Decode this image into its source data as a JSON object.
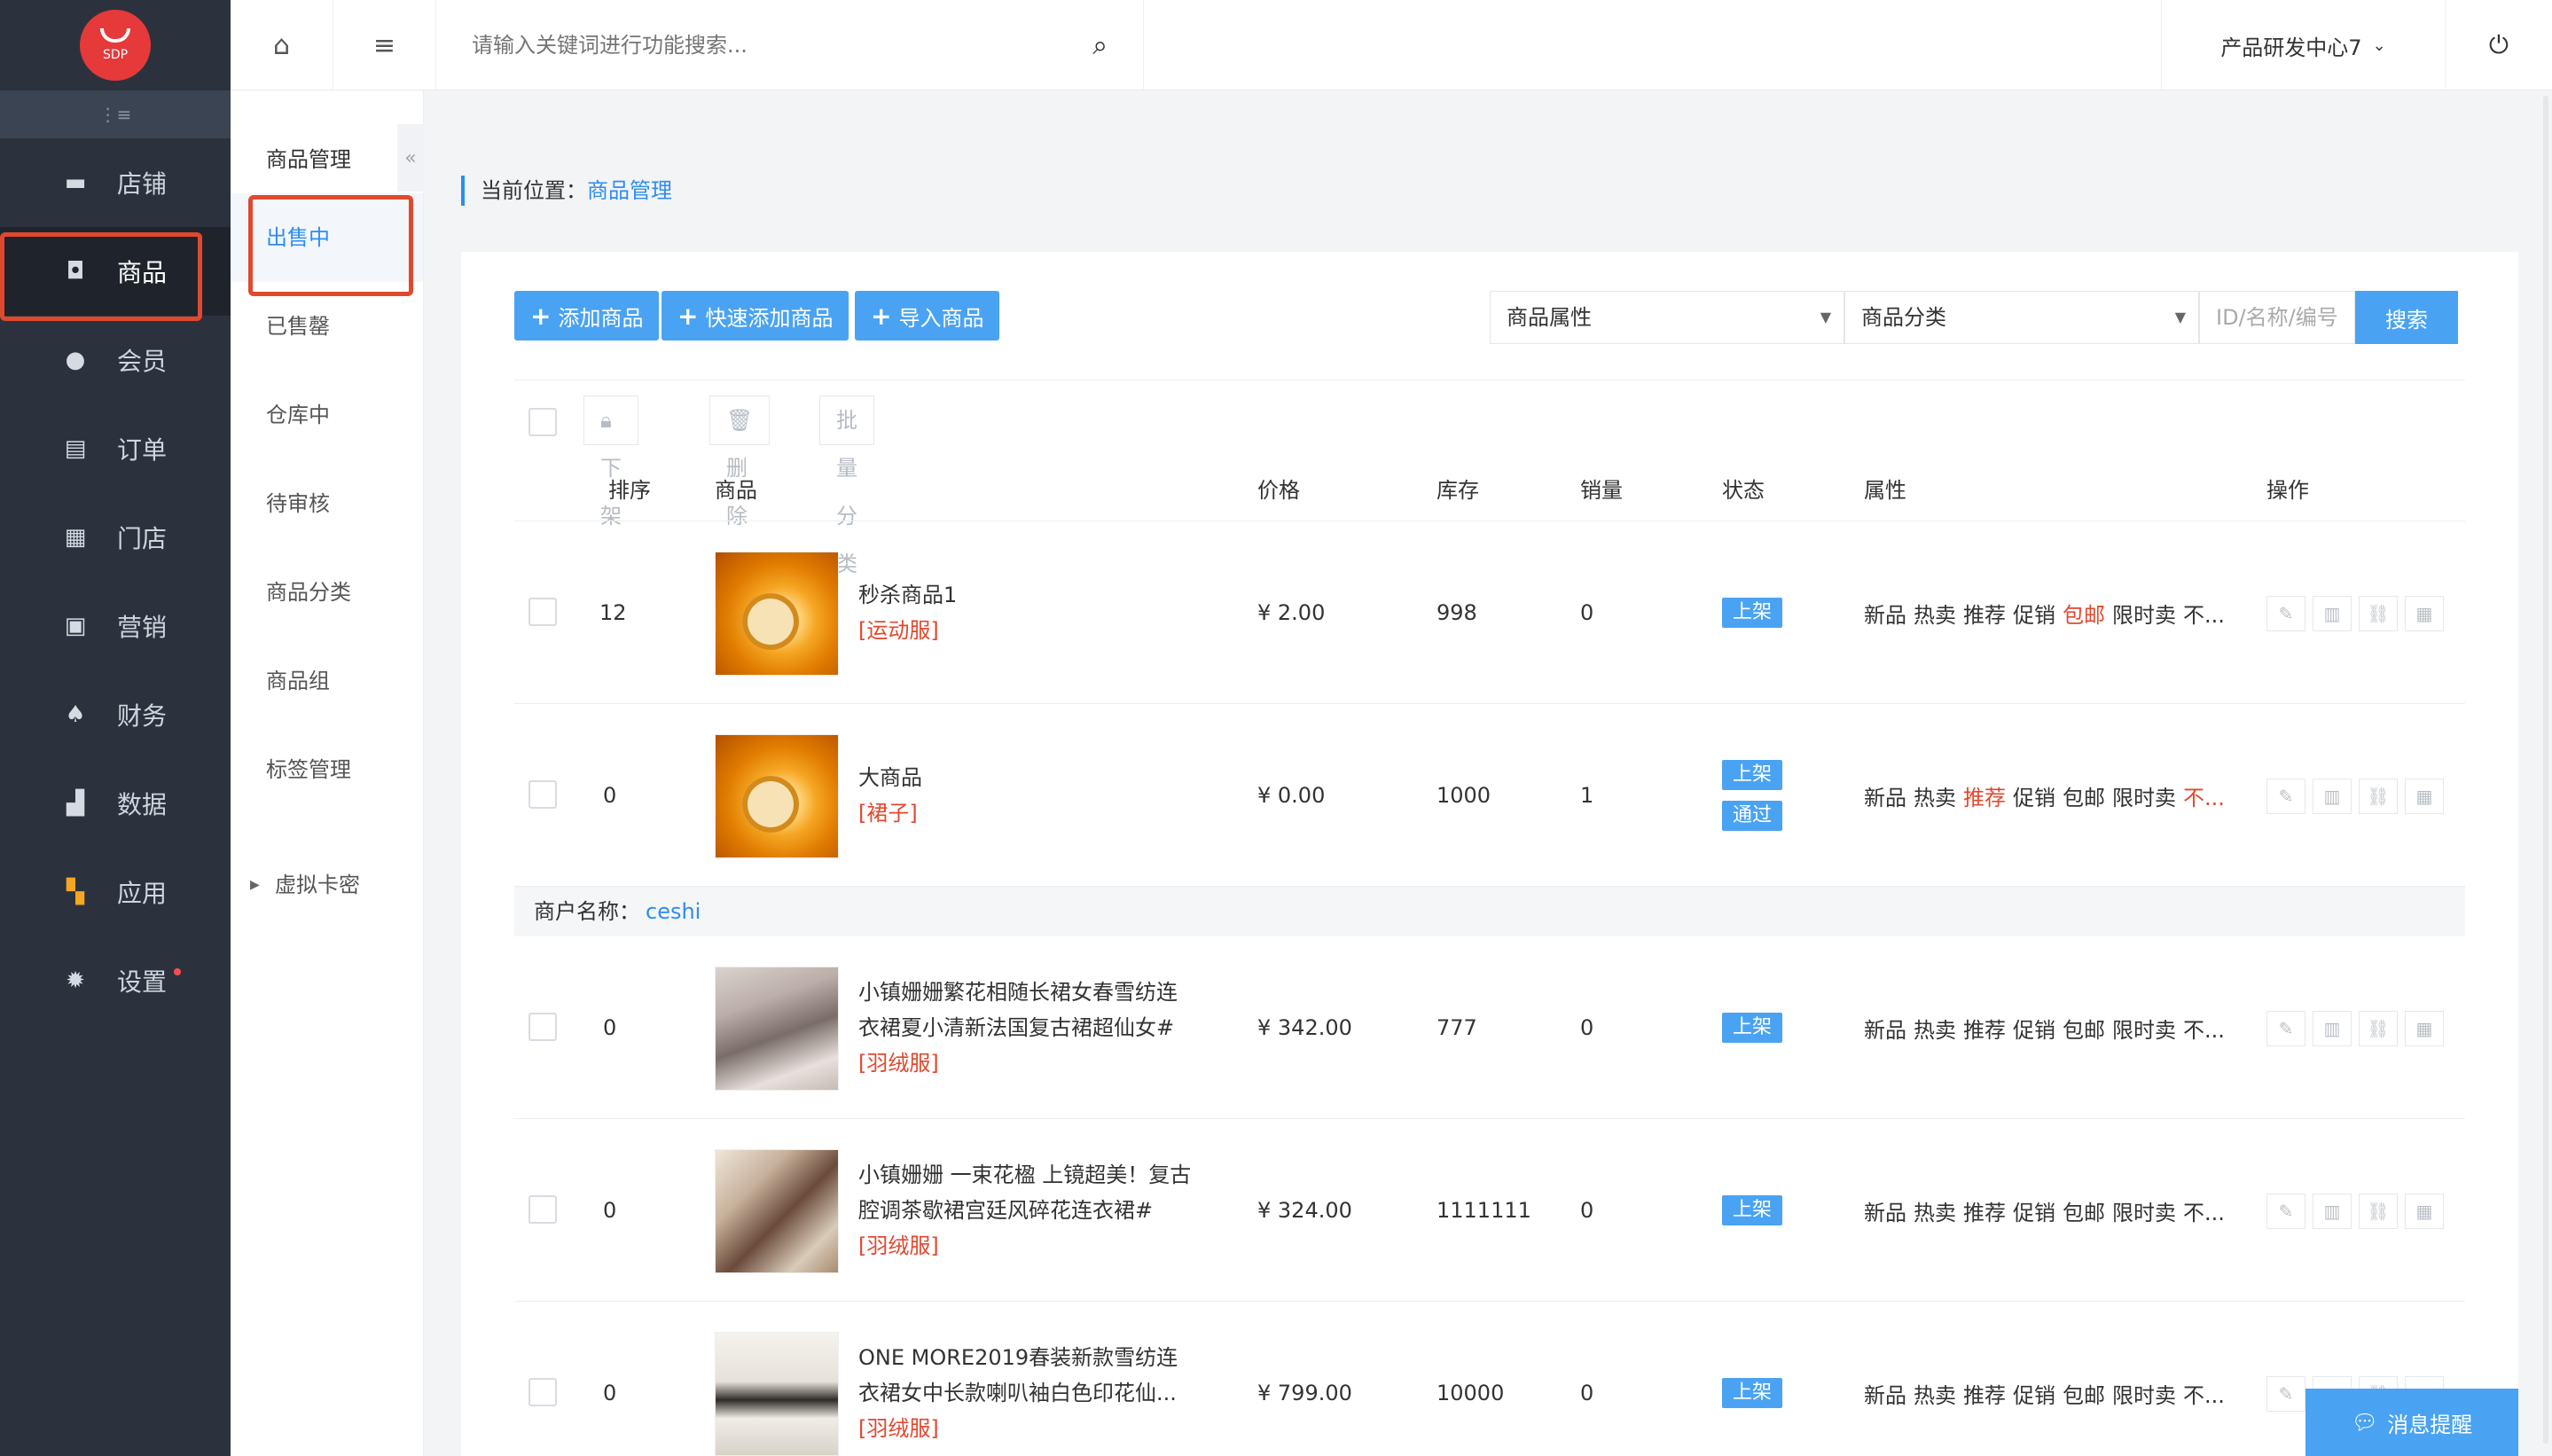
{
  "logo": {
    "text": "SDP"
  },
  "sidebar": {
    "collapse_icon": "collapse-icon",
    "items": [
      {
        "label": "店铺",
        "icon": "store-icon"
      },
      {
        "label": "商品",
        "icon": "bag-icon",
        "active": true
      },
      {
        "label": "会员",
        "icon": "user-icon"
      },
      {
        "label": "订单",
        "icon": "document-icon"
      },
      {
        "label": "门店",
        "icon": "shop-icon"
      },
      {
        "label": "营销",
        "icon": "gift-icon"
      },
      {
        "label": "财务",
        "icon": "money-bag-icon"
      },
      {
        "label": "数据",
        "icon": "bar-chart-icon"
      },
      {
        "label": "应用",
        "icon": "apps-icon"
      },
      {
        "label": "设置",
        "icon": "gear-icon",
        "dot": true
      }
    ]
  },
  "subsidebar": {
    "title": "商品管理",
    "items": [
      "出售中",
      "已售罄",
      "仓库中",
      "待审核",
      "商品分类",
      "商品组",
      "标签管理"
    ],
    "expandable": "虚拟卡密",
    "collapse_glyph": "«"
  },
  "topbar": {
    "search_placeholder": "请输入关键词进行功能搜索...",
    "user": "产品研发中心7",
    "user_caret": "⌄"
  },
  "breadcrumb": {
    "label": "当前位置：",
    "current": "商品管理"
  },
  "toolbar": {
    "add": "添加商品",
    "quick_add": "快速添加商品",
    "import": "导入商品",
    "attr_select": "商品属性",
    "cat_select": "商品分类",
    "id_placeholder": "ID/名称/编号",
    "search": "搜索"
  },
  "bulk": {
    "offshelf": "下架",
    "delete": "删除",
    "batch_category": "批量分类"
  },
  "table": {
    "headers": {
      "sort": "排序",
      "product": "商品",
      "price": "价格",
      "stock": "库存",
      "sales": "销量",
      "status": "状态",
      "attrs": "属性",
      "ops": "操作"
    },
    "rows": [
      {
        "sort": "12",
        "name": "秒杀商品1",
        "cat": "[运动服]",
        "price": "¥ 2.00",
        "stock": "998",
        "sales": "0",
        "status": [
          "上架"
        ],
        "attrs": [
          [
            "新品",
            false
          ],
          [
            "热卖",
            false
          ],
          [
            "推荐",
            false
          ],
          [
            "促销",
            false
          ],
          [
            "包邮",
            true
          ],
          [
            "限时卖",
            false
          ],
          [
            "不...",
            false
          ]
        ]
      },
      {
        "sort": "0",
        "name": "大商品",
        "cat": "[裙子]",
        "price": "¥ 0.00",
        "stock": "1000",
        "sales": "1",
        "status": [
          "上架",
          "通过"
        ],
        "attrs": [
          [
            "新品",
            false
          ],
          [
            "热卖",
            false
          ],
          [
            "推荐",
            true
          ],
          [
            "促销",
            false
          ],
          [
            "包邮",
            false
          ],
          [
            "限时卖",
            false
          ],
          [
            "不...",
            true
          ]
        ]
      },
      {
        "sort": "0",
        "name": "小镇姗姗繁花相随长裙女春雪纺连衣裙夏小清新法国复古裙超仙女#",
        "cat": "[羽绒服]",
        "price": "¥ 342.00",
        "stock": "777",
        "sales": "0",
        "status": [
          "上架"
        ],
        "attrs": [
          [
            "新品",
            false
          ],
          [
            "热卖",
            false
          ],
          [
            "推荐",
            false
          ],
          [
            "促销",
            false
          ],
          [
            "包邮",
            false
          ],
          [
            "限时卖",
            false
          ],
          [
            "不...",
            false
          ]
        ]
      },
      {
        "sort": "0",
        "name": "小镇姗姗 一束花楹 上镜超美！复古腔调茶歇裙宫廷风碎花连衣裙#",
        "cat": "[羽绒服]",
        "price": "¥ 324.00",
        "stock": "1111111",
        "sales": "0",
        "status": [
          "上架"
        ],
        "attrs": [
          [
            "新品",
            false
          ],
          [
            "热卖",
            false
          ],
          [
            "推荐",
            false
          ],
          [
            "促销",
            false
          ],
          [
            "包邮",
            false
          ],
          [
            "限时卖",
            false
          ],
          [
            "不...",
            false
          ]
        ]
      },
      {
        "sort": "0",
        "name": "ONE MORE2019春装新款雪纺连衣裙女中长款喇叭袖白色印花仙...",
        "cat": "[羽绒服]",
        "price": "¥ 799.00",
        "stock": "10000",
        "sales": "0",
        "status": [
          "上架"
        ],
        "attrs": [
          [
            "新品",
            false
          ],
          [
            "热卖",
            false
          ],
          [
            "推荐",
            false
          ],
          [
            "促销",
            false
          ],
          [
            "包邮",
            false
          ],
          [
            "限时卖",
            false
          ],
          [
            "不...",
            false
          ]
        ]
      }
    ],
    "merchant": {
      "label": "商户名称：",
      "value": "ceshi"
    }
  },
  "message_button": "消息提醒",
  "colors": {
    "accent": "#4aa3f2",
    "sidebar": "#2b323d",
    "highlight": "#e0492f"
  }
}
